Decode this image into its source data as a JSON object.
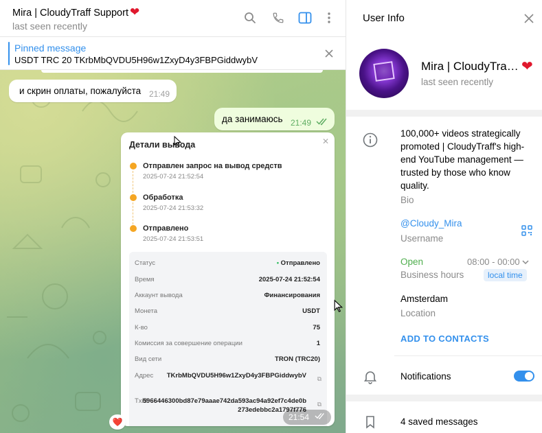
{
  "chat": {
    "title": "Mira | CloudyTraff Support",
    "status": "last seen recently",
    "pinned_label": "Pinned message",
    "pinned_text": "USDT TRC 20 TKrbMbQVDU5H96w1ZxyD4y3FBPGiddwybV",
    "messages": [
      {
        "text": "и скрин оплаты, пожалуйста",
        "time": "21:49",
        "direction": "in"
      },
      {
        "text": "да занимаюсь",
        "time": "21:49",
        "direction": "out"
      }
    ],
    "card": {
      "title": "Детали вывода",
      "steps": [
        {
          "title": "Отправлен запрос на вывод средств",
          "date": "2025-07-24 21:52:54"
        },
        {
          "title": "Обработка",
          "date": "2025-07-24 21:53:32"
        },
        {
          "title": "Отправлено",
          "date": "2025-07-24 21:53:51"
        }
      ],
      "rows": [
        {
          "label": "Статус",
          "value": "Отправлено"
        },
        {
          "label": "Время",
          "value": "2025-07-24 21:52:54"
        },
        {
          "label": "Аккаунт вывода",
          "value": "Финансирования"
        },
        {
          "label": "Монета",
          "value": "USDT"
        },
        {
          "label": "К-во",
          "value": "75"
        },
        {
          "label": "Комиссия за совершение операции",
          "value": "1"
        },
        {
          "label": "Вид сети",
          "value": "TRON (TRC20)"
        }
      ],
      "address_label": "Адрес",
      "address": "TKrbMbQVDU5H96w1ZxyD4y3FBPGiddwybV",
      "txid_label": "Txid",
      "txid": "5966446300bd87e79aaae742da593ac94a92ef7c4de0b273edebbc2a1797f776",
      "time": "21:54",
      "reaction": "❤️"
    }
  },
  "info": {
    "title": "User Info",
    "name": "Mira | CloudyTraff Support",
    "status": "last seen recently",
    "bio": "100,000+ videos strategically promoted | CloudyTraff's high-end YouTube management — trusted by those who know quality.",
    "bio_label": "Bio",
    "username": "@Cloudy_Mira",
    "username_label": "Username",
    "open_status": "Open",
    "hours": "08:00 - 00:00",
    "hours_label": "Business hours",
    "local_time": "local time",
    "location": "Amsterdam",
    "location_label": "Location",
    "add_contacts": "ADD TO CONTACTS",
    "notifications": "Notifications",
    "notifications_on": true,
    "saved": "4 saved messages"
  },
  "colors": {
    "accent": "#3390ec",
    "heart": "#e0182d",
    "step": "#f5a623",
    "open": "#4fae4e"
  }
}
